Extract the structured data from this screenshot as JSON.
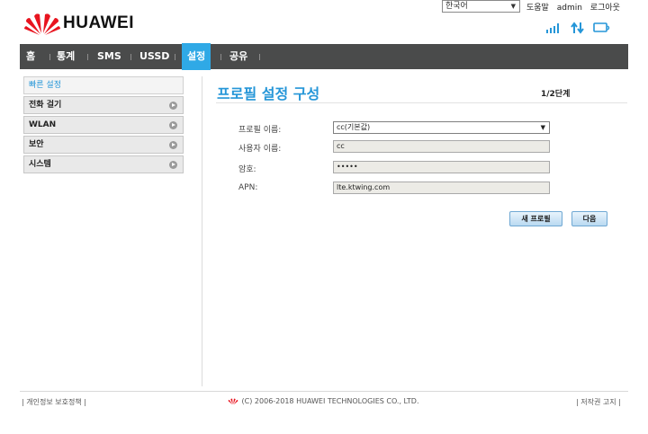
{
  "top": {
    "language": "한국어",
    "help": "도움말",
    "user": "admin",
    "logout": "로그아웃"
  },
  "brand": {
    "name": "HUAWEI"
  },
  "status_icons": [
    "signal-strength-icon",
    "data-transfer-icon",
    "pc-connection-icon"
  ],
  "nav": {
    "items": [
      {
        "label": "홈"
      },
      {
        "label": "통계"
      },
      {
        "label": "SMS"
      },
      {
        "label": "USSD"
      },
      {
        "label": "설정",
        "active": true
      },
      {
        "label": "공유"
      }
    ]
  },
  "sidebar": {
    "items": [
      {
        "label": "빠른 설정",
        "active": true
      },
      {
        "label": "전화 걸기"
      },
      {
        "label": "WLAN"
      },
      {
        "label": "보안"
      },
      {
        "label": "시스템"
      }
    ]
  },
  "main": {
    "title": "프로필 설정 구성",
    "step": "1/2단계",
    "fields": [
      {
        "label": "프로필 이름:",
        "value": "cc(기본값)"
      },
      {
        "label": "사용자 이름:",
        "value": "cc"
      },
      {
        "label": "암호:",
        "value": "•••••"
      },
      {
        "label": "APN:",
        "value": "lte.ktwing.com"
      }
    ],
    "buttons": {
      "new_profile": "새 프로필",
      "next": "다음"
    }
  },
  "footer": {
    "privacy": "| 개인정보 보호정책 |",
    "copyright": "(C) 2006-2018 HUAWEI TECHNOLOGIES CO., LTD.",
    "copyright_right": "| 저작권 고지 |"
  },
  "colors": {
    "accent": "#2fa9e6",
    "nav_bg": "#4a4b4b",
    "brand_red": "#e8141f"
  }
}
